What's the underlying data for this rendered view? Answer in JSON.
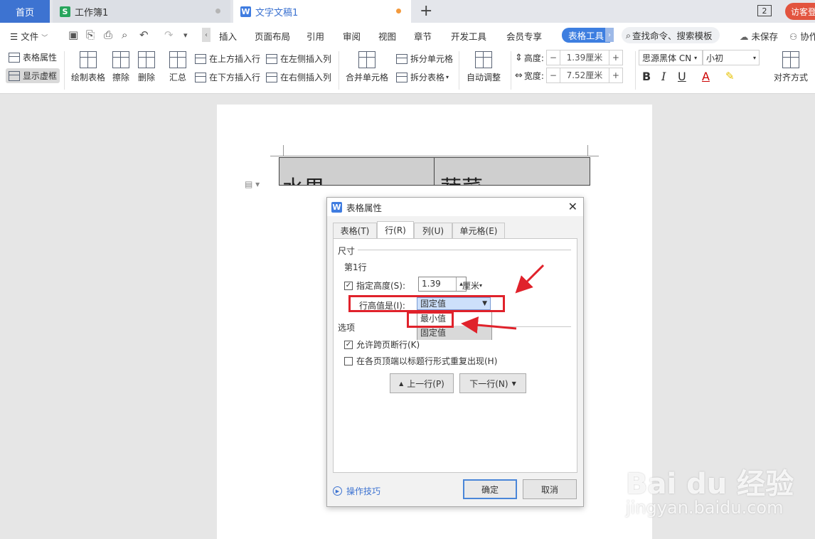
{
  "tabs": {
    "home": "首页",
    "workbook": "工作簿1",
    "document": "文字文稿1",
    "count": "2",
    "visitor": "访客登"
  },
  "menu": {
    "file": "文件",
    "items": [
      "插入",
      "页面布局",
      "引用",
      "审阅",
      "视图",
      "章节",
      "开发工具",
      "会员专享"
    ],
    "table_tools": "表格工具",
    "search": "查找命令、搜索模板",
    "unsaved": "未保存",
    "collab": "协作"
  },
  "toolbar": {
    "table_props": "表格属性",
    "show_gridlines": "显示虚框",
    "draw_table": "绘制表格",
    "erase": "擦除",
    "delete": "删除",
    "summary": "汇总",
    "insert_above": "在上方插入行",
    "insert_below": "在下方插入行",
    "insert_left": "在左侧插入列",
    "insert_right": "在右侧插入列",
    "merge_cells": "合并单元格",
    "split_cells": "拆分单元格",
    "split_table": "拆分表格",
    "auto_fit": "自动调整",
    "height_label": "高度:",
    "height_value": "1.39厘米",
    "width_label": "宽度:",
    "width_value": "7.52厘米",
    "font_name": "思源黑体 CN",
    "font_size": "小初",
    "align": "对齐方式"
  },
  "document": {
    "cell1": "水果",
    "cell2": "蔬菜"
  },
  "dialog": {
    "title": "表格属性",
    "tabs": [
      "表格(T)",
      "行(R)",
      "列(U)",
      "单元格(E)"
    ],
    "size_group": "尺寸",
    "row_label": "第1行",
    "specify_height": "指定高度(S):",
    "height_value": "1.39",
    "unit": "厘米",
    "row_height_is": "行高值是(I):",
    "selected_mode": "固定值",
    "options_list": [
      "最小值",
      "固定值"
    ],
    "options_group": "选项",
    "allow_break": "允许跨页断行(K)",
    "repeat_header": "在各页顶端以标题行形式重复出现(H)",
    "prev_row": "上一行(P)",
    "next_row": "下一行(N)",
    "tips": "操作技巧",
    "ok": "确定",
    "cancel": "取消"
  },
  "watermark": {
    "logo": "Bai du 经验",
    "url": "jingyan.baidu.com"
  },
  "colors": {
    "accent": "#3d73d1",
    "highlight": "#e0222b"
  }
}
